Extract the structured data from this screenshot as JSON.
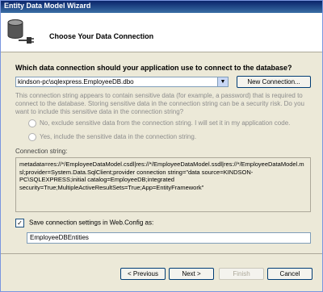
{
  "window": {
    "title": "Entity Data Model Wizard"
  },
  "header": {
    "heading": "Choose Your Data Connection"
  },
  "question": "Which data connection should your application use to connect to the database?",
  "connection_combo": {
    "value": "kindson-pc\\sqlexpress.EmployeeDB.dbo"
  },
  "new_connection_button": "New Connection...",
  "sensitive_warning": "This connection string appears to contain sensitive data (for example, a password) that is required to connect to the database. Storing sensitive data in the connection string can be a security risk. Do you want to include this sensitive data in the connection string?",
  "radio_no": "No, exclude sensitive data from the connection string. I will set it in my application code.",
  "radio_yes": "Yes, include the sensitive data in the connection string.",
  "connection_string_label": "Connection string:",
  "connection_string": "metadata=res://*/EmployeeDataModel.csdl|res://*/EmployeeDataModel.ssdl|res://*/EmployeeDataModel.msl;provider=System.Data.SqlClient;provider connection string=\"data source=KINDSON-PC\\SQLEXPRESS;initial catalog=EmployeeDB;integrated security=True;MultipleActiveResultSets=True;App=EntityFramework\"",
  "save_settings": {
    "label": "Save connection settings in Web.Config as:",
    "checked": "✓"
  },
  "entities_name": "EmployeeDBEntities",
  "buttons": {
    "previous": "< Previous",
    "next": "Next >",
    "finish": "Finish",
    "cancel": "Cancel"
  }
}
